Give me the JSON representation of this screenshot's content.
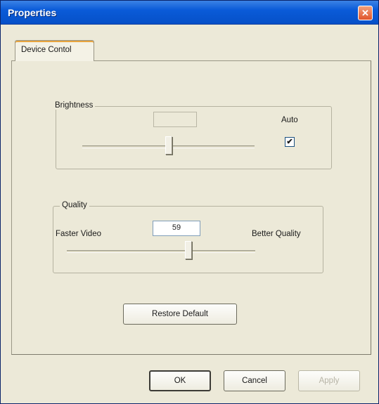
{
  "window": {
    "title": "Properties"
  },
  "tabs": [
    {
      "label": "Device Contol",
      "selected": true
    }
  ],
  "brightness": {
    "group_label": "Brightness",
    "value": "",
    "value_enabled": false,
    "auto_label": "Auto",
    "auto_checked": true,
    "auto_check_glyph": "☑"
  },
  "quality": {
    "group_label": "Quality",
    "value": "59",
    "left_label": "Faster Video",
    "right_label": "Better Quality"
  },
  "buttons": {
    "restore_default": "Restore Default",
    "ok": "OK",
    "cancel": "Cancel",
    "apply": "Apply"
  },
  "icons": {
    "close": "close-icon"
  }
}
